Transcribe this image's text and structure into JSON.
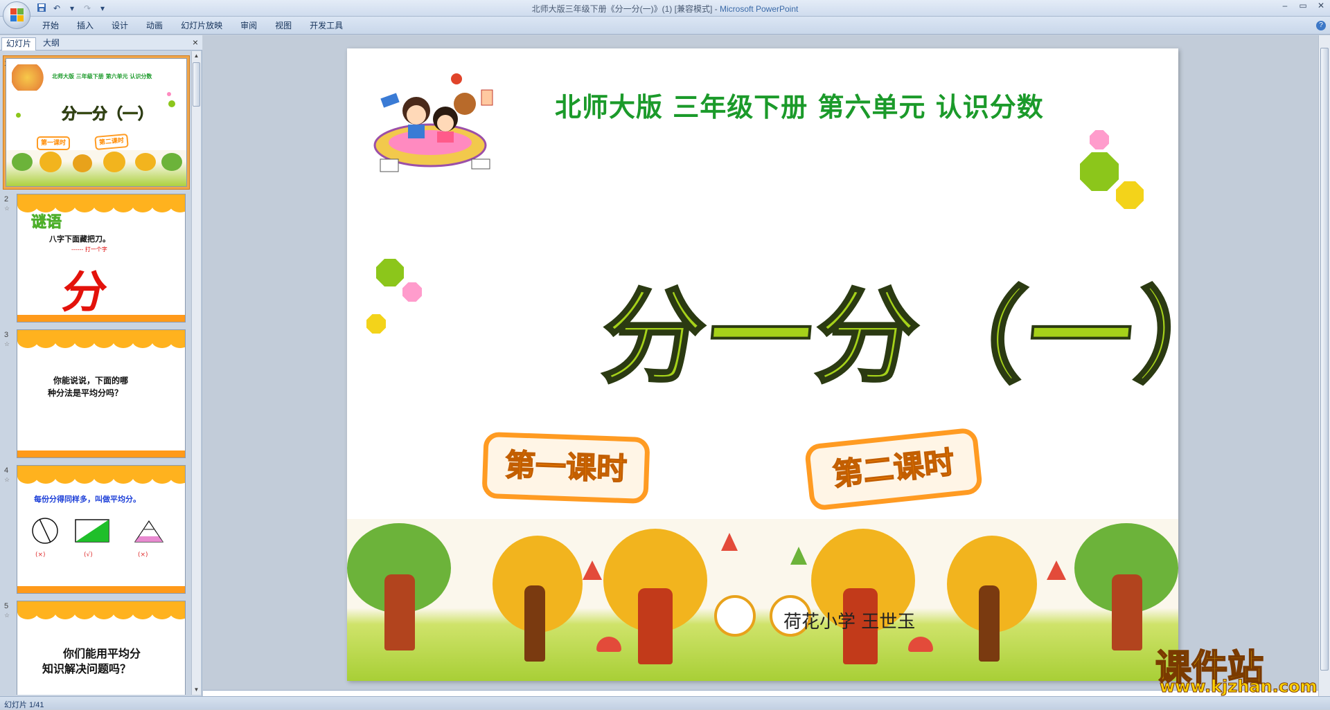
{
  "window": {
    "title_doc": "北师大版三年级下册《分一分(一)》(1) [兼容模式]",
    "title_sep": " - ",
    "title_app": "Microsoft PowerPoint"
  },
  "qat": {
    "save_icon": "save-icon",
    "undo_icon": "undo-icon",
    "redo_icon": "redo-icon",
    "customize_icon": "dropdown-icon"
  },
  "ribbon": {
    "tabs": [
      "开始",
      "插入",
      "设计",
      "动画",
      "幻灯片放映",
      "审阅",
      "视图",
      "开发工具"
    ],
    "help": "?"
  },
  "panel": {
    "tab_slides": "幻灯片",
    "tab_outline": "大纲",
    "close": "×"
  },
  "thumbnails": [
    {
      "num": "1",
      "title": "北师大版  三年级下册  第六单元  认识分数",
      "big": "分一分（一）",
      "btn1": "第一课时",
      "btn2": "第二课时"
    },
    {
      "num": "2",
      "star": "☆",
      "riddle": "谜语",
      "line1": "八字下面藏把刀。",
      "line2": "------  打一个字",
      "answer": "分"
    },
    {
      "num": "3",
      "star": "☆",
      "text1": "你能说说，下面的哪",
      "text2": "种分法是平均分吗？"
    },
    {
      "num": "4",
      "star": "☆",
      "text": "每份分得同样多，叫做平均分。",
      "marks": [
        "(×)",
        "(√)",
        "(×)"
      ]
    },
    {
      "num": "5",
      "star": "☆",
      "text1": "你们能用平均分",
      "text2": "知识解决问题吗？"
    }
  ],
  "slide": {
    "title": "北师大版  三年级下册  第六单元  认识分数",
    "big_title": "分一分（一）",
    "lesson1": "第一课时",
    "lesson2": "第二课时",
    "author": "荷花小学    王世玉"
  },
  "status": {
    "slide_counter": "幻灯片 1/41"
  },
  "watermark": {
    "name": "课件站",
    "url": "www.kjzhan.com"
  },
  "colors": {
    "title_green": "#1b9a2a",
    "accent_orange": "#ff9b22",
    "big_title_lime": "#a6d21a"
  }
}
